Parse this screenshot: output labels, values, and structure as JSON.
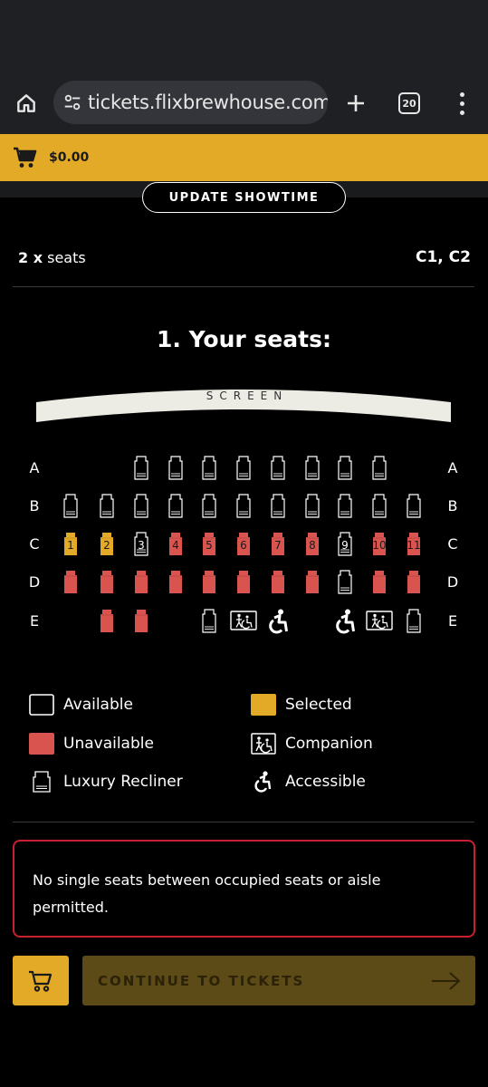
{
  "browser": {
    "url": "tickets.flixbrewhouse.com/",
    "tab_count": "20",
    "icons": [
      "home-icon",
      "site-settings-icon",
      "plus-icon",
      "tabs-icon",
      "more-vert-icon"
    ]
  },
  "cart": {
    "total": "$0.00",
    "icon": "cart-icon"
  },
  "showtime": {
    "update_label": "UPDATE SHOWTIME"
  },
  "selection": {
    "count": "2 x",
    "count_suffix": " seats",
    "seats": "C1, C2"
  },
  "section": {
    "title": "1. Your seats:"
  },
  "screen": {
    "label": "SCREEN"
  },
  "colors": {
    "selected": "#e3aa27",
    "unavailable": "#d9534f",
    "available_outline": "#ffffff",
    "notice_border": "#c8202f",
    "accent": "#e3aa27"
  },
  "seat_map": {
    "rows": [
      {
        "label": "A",
        "seats": [
          {
            "num": "",
            "status": "available"
          },
          {
            "num": "",
            "status": "available"
          },
          {
            "num": "",
            "status": "available"
          },
          {
            "num": "",
            "status": "available"
          },
          {
            "num": "",
            "status": "available"
          },
          {
            "num": "",
            "status": "available"
          },
          {
            "num": "",
            "status": "available"
          },
          {
            "num": "",
            "status": "available"
          }
        ]
      },
      {
        "label": "B",
        "seats": [
          {
            "num": "",
            "status": "available"
          },
          {
            "num": "",
            "status": "available"
          },
          {
            "num": "",
            "status": "available"
          },
          {
            "num": "",
            "status": "available"
          },
          {
            "num": "",
            "status": "available"
          },
          {
            "num": "",
            "status": "available"
          },
          {
            "num": "",
            "status": "available"
          },
          {
            "num": "",
            "status": "available"
          },
          {
            "num": "",
            "status": "available"
          },
          {
            "num": "",
            "status": "available"
          },
          {
            "num": "",
            "status": "available"
          }
        ]
      },
      {
        "label": "C",
        "seats": [
          {
            "num": "1",
            "status": "selected"
          },
          {
            "num": "2",
            "status": "selected"
          },
          {
            "num": "3",
            "status": "available"
          },
          {
            "num": "4",
            "status": "unavailable"
          },
          {
            "num": "5",
            "status": "unavailable"
          },
          {
            "num": "6",
            "status": "unavailable"
          },
          {
            "num": "7",
            "status": "unavailable"
          },
          {
            "num": "8",
            "status": "unavailable"
          },
          {
            "num": "9",
            "status": "available"
          },
          {
            "num": "10",
            "status": "unavailable"
          },
          {
            "num": "11",
            "status": "unavailable"
          }
        ]
      },
      {
        "label": "D",
        "seats": [
          {
            "num": "",
            "status": "unavailable"
          },
          {
            "num": "",
            "status": "unavailable"
          },
          {
            "num": "",
            "status": "unavailable"
          },
          {
            "num": "",
            "status": "unavailable"
          },
          {
            "num": "",
            "status": "unavailable"
          },
          {
            "num": "",
            "status": "unavailable"
          },
          {
            "num": "",
            "status": "unavailable"
          },
          {
            "num": "",
            "status": "unavailable"
          },
          {
            "num": "",
            "status": "available"
          },
          {
            "num": "",
            "status": "unavailable"
          },
          {
            "num": "",
            "status": "unavailable"
          }
        ]
      },
      {
        "label": "E",
        "seats": [
          {
            "num": "",
            "status": "unavailable"
          },
          {
            "num": "",
            "status": "unavailable"
          },
          {
            "num": "",
            "status": "available"
          },
          {
            "num": "",
            "status": "companion"
          },
          {
            "num": "",
            "status": "accessible"
          },
          {
            "num": "",
            "status": "accessible"
          },
          {
            "num": "",
            "status": "companion"
          },
          {
            "num": "",
            "status": "available"
          }
        ]
      }
    ]
  },
  "legend": [
    {
      "label": "Available",
      "icon": "available-box-icon"
    },
    {
      "label": "Selected",
      "icon": "selected-box-icon"
    },
    {
      "label": "Unavailable",
      "icon": "unavailable-box-icon"
    },
    {
      "label": "Companion",
      "icon": "companion-icon"
    },
    {
      "label": "Luxury Recliner",
      "icon": "recliner-icon"
    },
    {
      "label": "Accessible",
      "icon": "wheelchair-icon"
    }
  ],
  "notice": {
    "text": "No single seats between occupied seats or aisle permitted."
  },
  "actions": {
    "continue_label": "CONTINUE TO TICKETS",
    "icons": [
      "cart-icon",
      "arrow-right-icon"
    ]
  }
}
